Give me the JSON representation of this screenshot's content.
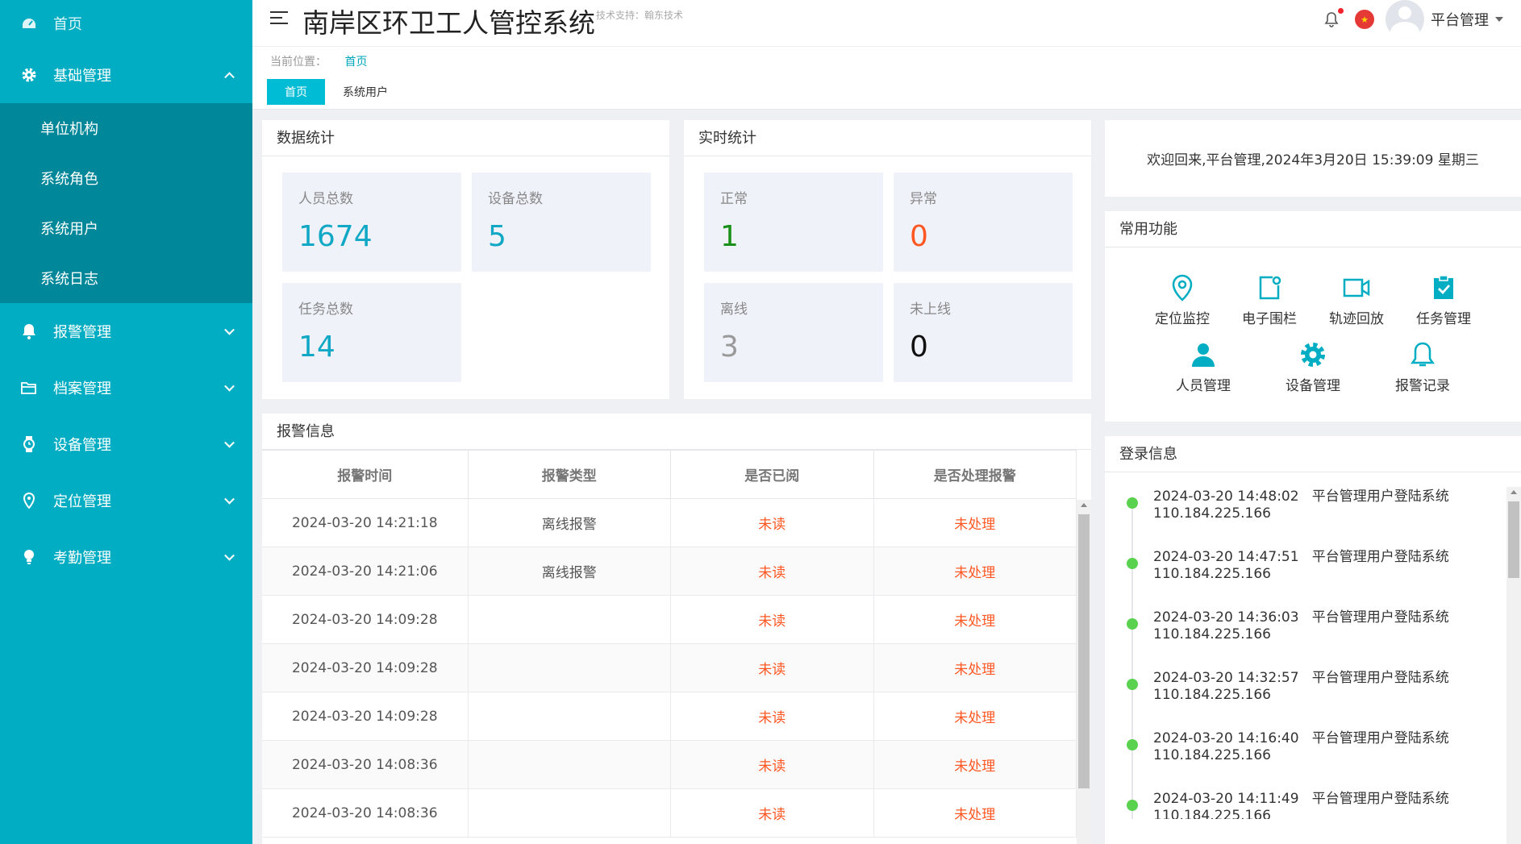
{
  "sidebar": {
    "home": "首页",
    "basic": {
      "label": "基础管理",
      "items": [
        "单位机构",
        "系统角色",
        "系统用户",
        "系统日志"
      ]
    },
    "menus": [
      "报警管理",
      "档案管理",
      "设备管理",
      "定位管理",
      "考勤管理"
    ]
  },
  "header": {
    "title": "南岸区环卫工人管控系统",
    "tech": "技术支持：翰东技术",
    "user": "平台管理"
  },
  "breadcrumb": {
    "label": "当前位置：",
    "current": "首页"
  },
  "tabs": [
    "首页",
    "系统用户"
  ],
  "data_stats": {
    "title": "数据统计",
    "items": [
      {
        "label": "人员总数",
        "value": "1674"
      },
      {
        "label": "设备总数",
        "value": "5"
      },
      {
        "label": "任务总数",
        "value": "14"
      }
    ]
  },
  "realtime_stats": {
    "title": "实时统计",
    "items": [
      {
        "label": "正常",
        "value": "1"
      },
      {
        "label": "异常",
        "value": "0"
      },
      {
        "label": "离线",
        "value": "3"
      },
      {
        "label": "未上线",
        "value": "0"
      }
    ]
  },
  "welcome": "欢迎回来,平台管理,2024年3月20日 15:39:09 星期三",
  "functions": {
    "title": "常用功能",
    "row1": [
      "定位监控",
      "电子围栏",
      "轨迹回放",
      "任务管理"
    ],
    "row2": [
      "人员管理",
      "设备管理",
      "报警记录"
    ]
  },
  "alarms": {
    "title": "报警信息",
    "headers": [
      "报警时间",
      "报警类型",
      "是否已阅",
      "是否处理报警"
    ],
    "rows": [
      [
        "2024-03-20 14:21:18",
        "离线报警",
        "未读",
        "未处理"
      ],
      [
        "2024-03-20 14:21:06",
        "离线报警",
        "未读",
        "未处理"
      ],
      [
        "2024-03-20 14:09:28",
        "",
        "未读",
        "未处理"
      ],
      [
        "2024-03-20 14:09:28",
        "",
        "未读",
        "未处理"
      ],
      [
        "2024-03-20 14:09:28",
        "",
        "未读",
        "未处理"
      ],
      [
        "2024-03-20 14:08:36",
        "",
        "未读",
        "未处理"
      ],
      [
        "2024-03-20 14:08:36",
        "",
        "未读",
        "未处理"
      ]
    ]
  },
  "login": {
    "title": "登录信息",
    "items": [
      {
        "line1": "2024-03-20 14:48:02   平台管理用户登陆系统",
        "line2": "110.184.225.166"
      },
      {
        "line1": "2024-03-20 14:47:51   平台管理用户登陆系统",
        "line2": "110.184.225.166"
      },
      {
        "line1": "2024-03-20 14:36:03   平台管理用户登陆系统",
        "line2": "110.184.225.166"
      },
      {
        "line1": "2024-03-20 14:32:57   平台管理用户登陆系统",
        "line2": "110.184.225.166"
      },
      {
        "line1": "2024-03-20 14:16:40   平台管理用户登陆系统",
        "line2": "110.184.225.166"
      },
      {
        "line1": "2024-03-20 14:11:49   平台管理用户登陆系统",
        "line2": "110.184.225.166"
      }
    ]
  },
  "colors": {
    "accent": "#00adc2",
    "submenu": "#00889a",
    "teal_number": "#11a8c6",
    "green_number": "#1a8f1a",
    "orange_number": "#ff5722",
    "gray_number": "#999999",
    "unread_red": "#ff5722",
    "timeline_dot": "#5ad14f"
  }
}
